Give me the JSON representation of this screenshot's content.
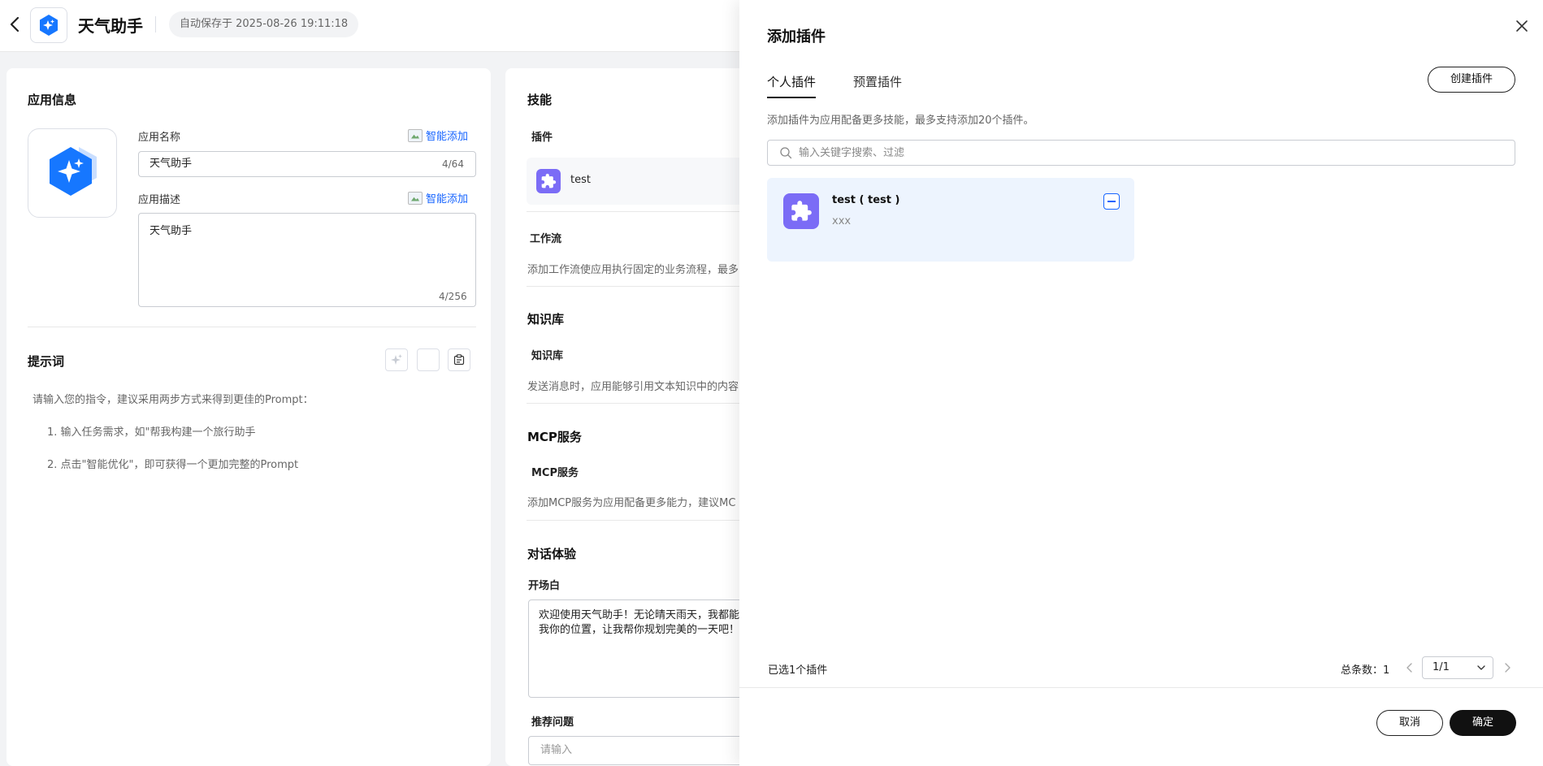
{
  "header": {
    "app_name": "天气助手",
    "autosave": "自动保存于 2025-08-26 19:11:18"
  },
  "app_info": {
    "section_title": "应用信息",
    "name_label": "应用名称",
    "smart_add": "智能添加",
    "name_value": "天气助手",
    "name_counter": "4/64",
    "desc_label": "应用描述",
    "desc_value": "天气助手",
    "desc_counter": "4/256"
  },
  "prompt": {
    "section_title": "提示词",
    "intro": "请输入您的指令，建议采用两步方式来得到更佳的Prompt：",
    "step1": "1. 输入任务需求，如\"帮我构建一个旅行助手",
    "step2": "2. 点击\"智能优化\"，即可获得一个更加完整的Prompt"
  },
  "skills": {
    "section_title": "技能",
    "plugin_label": "插件",
    "plugin_item": "test",
    "workflow_label": "工作流",
    "workflow_desc": "添加工作流使应用执行固定的业务流程，最多",
    "kb_section": "知识库",
    "kb_label": "知识库",
    "kb_desc": "发送消息时，应用能够引用文本知识中的内容",
    "mcp_section": "MCP服务",
    "mcp_label": "MCP服务",
    "mcp_desc": "添加MCP服务为应用配备更多能力，建议MC",
    "chat_section": "对话体验",
    "opening_label": "开场白",
    "opening_text": "欢迎使用天气助手！无论晴天雨天，我都能\n我你的位置，让我帮你规划完美的一天吧！",
    "suggest_label": "推荐问题",
    "suggest_placeholder": "请输入"
  },
  "drawer": {
    "title": "添加插件",
    "tabs": [
      "个人插件",
      "预置插件"
    ],
    "active_tab": 0,
    "create_button": "创建插件",
    "description": "添加插件为应用配备更多技能，最多支持添加20个插件。",
    "search_placeholder": "输入关键字搜索、过滤",
    "plugins": [
      {
        "name": "test ( test )",
        "desc": "xxx",
        "selected": true
      }
    ],
    "selected_count": "已选1个插件",
    "total_label": "总条数：",
    "total_value": "1",
    "page_value": "1/1",
    "cancel": "取消",
    "confirm": "确定"
  },
  "colors": {
    "accent": "#1664ff",
    "plugin_icon_bg": "#7b6cf6",
    "selected_card_bg": "#edf4fe",
    "primary_button": "#111111"
  }
}
